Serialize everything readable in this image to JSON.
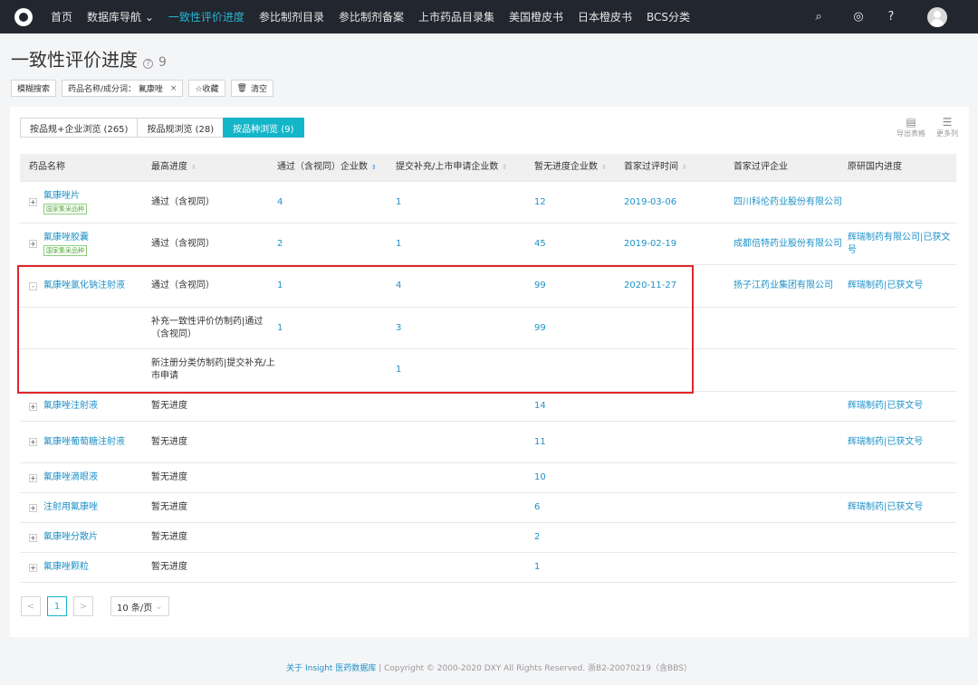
{
  "nav": {
    "items": [
      "首页",
      "数据库导航",
      "一致性评价进度",
      "参比制剂目录",
      "参比制剂备案",
      "上市药品目录集",
      "美国橙皮书",
      "日本橙皮书",
      "BCS分类"
    ],
    "active_index": 2
  },
  "page": {
    "title": "一致性评价进度",
    "count": "9"
  },
  "filters": {
    "fuzzy": "模糊搜索",
    "keyword": "药品名称/成分词： 氟康唑",
    "fav": "☆收藏",
    "clear": "清空"
  },
  "tabs": [
    "按品规+企业浏览 (265)",
    "按品规浏览 (28)",
    "按品种浏览 (9)"
  ],
  "tools": {
    "export": "导出表格",
    "more": "更多列"
  },
  "table": {
    "headers": [
      "药品名称",
      "最高进度",
      "通过（含视同）企业数",
      "提交补充/上市申请企业数",
      "暂无进度企业数",
      "首家过评时间",
      "首家过评企业",
      "原研国内进度"
    ],
    "rows": [
      {
        "exp": "+",
        "name": "氟康唑片",
        "badge": "国家集采品种",
        "progress": "通过（含视同）",
        "passed": "4",
        "submitted": "1",
        "none": "12",
        "date": "2019-03-06",
        "company": "四川科伦药业股份有限公司",
        "orig": ""
      },
      {
        "exp": "+",
        "name": "氟康唑胶囊",
        "badge": "国家集采品种",
        "progress": "通过（含视同）",
        "passed": "2",
        "submitted": "1",
        "none": "45",
        "date": "2019-02-19",
        "company": "成都倍特药业股份有限公司",
        "orig": "辉瑞制药有限公司|已获文号"
      },
      {
        "exp": "-",
        "name": "氟康唑氯化钠注射液",
        "badge": "",
        "progress": "通过（含视同）",
        "passed": "1",
        "submitted": "4",
        "none": "99",
        "date": "2020-11-27",
        "company": "扬子江药业集团有限公司",
        "orig": "辉瑞制药|已获文号"
      },
      {
        "exp": "",
        "name": "",
        "badge": "",
        "progress": "补充一致性评价仿制药|通过（含视同）",
        "passed": "1",
        "submitted": "3",
        "none": "99",
        "date": "",
        "company": "",
        "orig": ""
      },
      {
        "exp": "",
        "name": "",
        "badge": "",
        "progress": "新注册分类仿制药|提交补充/上市申请",
        "passed": "",
        "submitted": "1",
        "none": "",
        "date": "",
        "company": "",
        "orig": ""
      },
      {
        "exp": "+",
        "name": "氟康唑注射液",
        "badge": "",
        "progress": "暂无进度",
        "passed": "",
        "submitted": "",
        "none": "14",
        "date": "",
        "company": "",
        "orig": "辉瑞制药|已获文号"
      },
      {
        "exp": "+",
        "name": "氟康唑葡萄糖注射液",
        "badge": "",
        "progress": "暂无进度",
        "passed": "",
        "submitted": "",
        "none": "11",
        "date": "",
        "company": "",
        "orig": "辉瑞制药|已获文号"
      },
      {
        "exp": "+",
        "name": "氟康唑滴眼液",
        "badge": "",
        "progress": "暂无进度",
        "passed": "",
        "submitted": "",
        "none": "10",
        "date": "",
        "company": "",
        "orig": ""
      },
      {
        "exp": "+",
        "name": "注射用氟康唑",
        "badge": "",
        "progress": "暂无进度",
        "passed": "",
        "submitted": "",
        "none": "6",
        "date": "",
        "company": "",
        "orig": "辉瑞制药|已获文号"
      },
      {
        "exp": "+",
        "name": "氟康唑分散片",
        "badge": "",
        "progress": "暂无进度",
        "passed": "",
        "submitted": "",
        "none": "2",
        "date": "",
        "company": "",
        "orig": ""
      },
      {
        "exp": "+",
        "name": "氟康唑颗粒",
        "badge": "",
        "progress": "暂无进度",
        "passed": "",
        "submitted": "",
        "none": "1",
        "date": "",
        "company": "",
        "orig": ""
      }
    ]
  },
  "pager": {
    "prev": "<",
    "current": "1",
    "next": ">",
    "size": "10 条/页"
  },
  "footer": {
    "about": "关于 Insight 医药数据库",
    "copyright": " | Copyright © 2000-2020 DXY All Rights Reserved. 浙B2-20070219（含BBS）"
  },
  "colors": {
    "nav_bg": "#22262f",
    "accent": "#13b5c9",
    "link": "#1e91c7",
    "highlight": "#e0262b"
  }
}
